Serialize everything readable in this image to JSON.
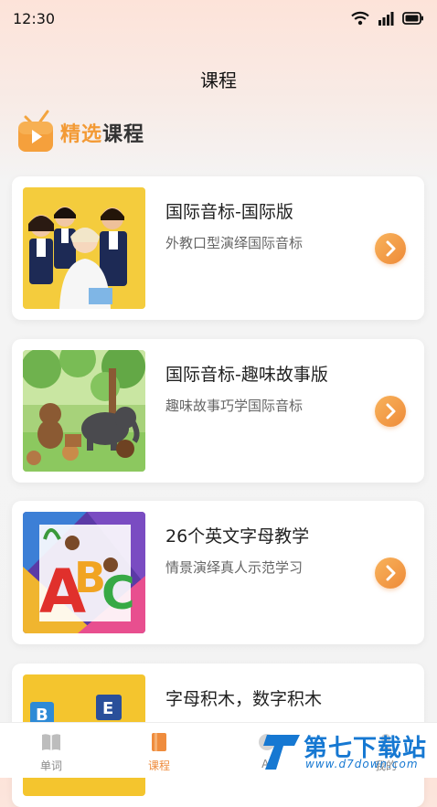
{
  "status_bar": {
    "time": "12:30"
  },
  "header": {
    "title": "课程"
  },
  "section": {
    "title_part1": "精选",
    "title_part2": "课程"
  },
  "courses": [
    {
      "title": "国际音标-国际版",
      "subtitle": "外教口型演绎国际音标"
    },
    {
      "title": "国际音标-趣味故事版",
      "subtitle": "趣味故事巧学国际音标"
    },
    {
      "title": "26个英文字母教学",
      "subtitle": "情景演绎真人示范学习"
    },
    {
      "title": "字母积木，数字积木",
      "subtitle": ""
    }
  ],
  "tabs": [
    {
      "label": "单词",
      "icon": "book-icon"
    },
    {
      "label": "课程",
      "icon": "course-book-icon"
    },
    {
      "label": "AI",
      "icon": "ai-icon"
    },
    {
      "label": "我的",
      "icon": "profile-icon"
    }
  ],
  "active_tab": "课程",
  "watermark": {
    "title": "第七下载站",
    "url": "www.d7down.com"
  },
  "colors": {
    "accent": "#ef8c3d",
    "background": "#f3f3f3",
    "watermark": "#1678d2"
  }
}
